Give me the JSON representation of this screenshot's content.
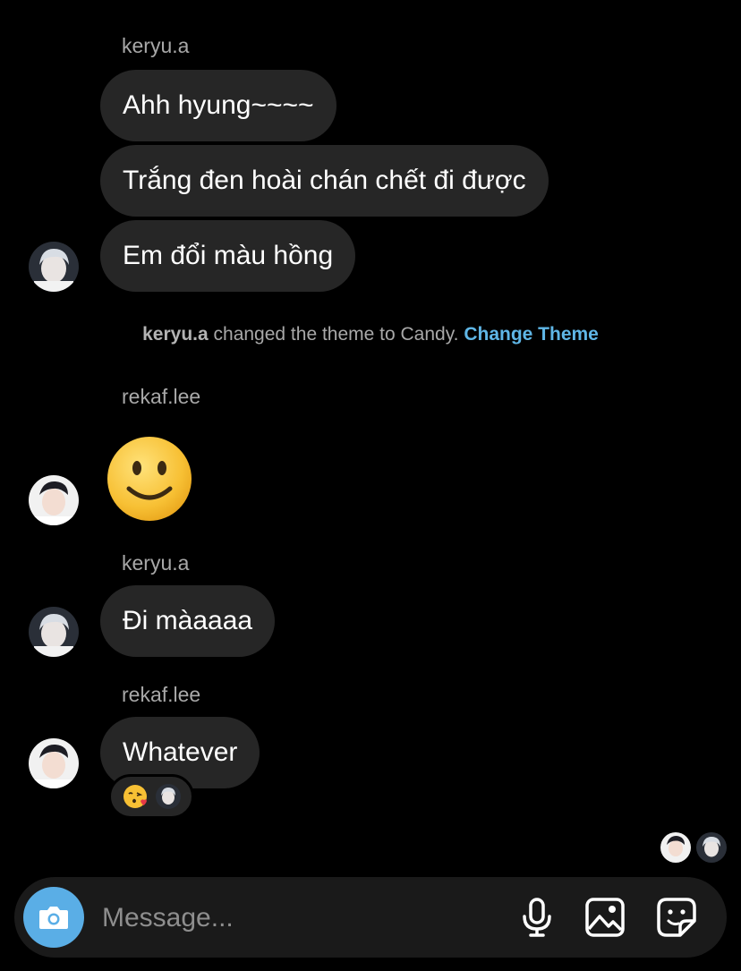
{
  "messages": [
    {
      "sender": "keryu.a",
      "texts": [
        "Ahh hyung~~~~",
        "Trắng đen hoài chán chết đi được",
        "Em đổi màu hồng"
      ]
    },
    {
      "system": {
        "user": "keryu.a",
        "text": " changed the theme to Candy. ",
        "link": "Change Theme"
      }
    },
    {
      "sender": "rekaf.lee",
      "emoji": "slightly-smiling-face"
    },
    {
      "sender": "keryu.a",
      "texts": [
        "Đi màaaaa"
      ]
    },
    {
      "sender": "rekaf.lee",
      "texts": [
        "Whatever"
      ],
      "reaction": "kissing-heart-emoji"
    }
  ],
  "composer": {
    "placeholder": "Message...",
    "icons": [
      "camera-icon",
      "microphone-icon",
      "gallery-icon",
      "sticker-icon"
    ]
  },
  "colors": {
    "background": "#000000",
    "bubble": "#262626",
    "accent": "#5aaee6",
    "link": "#5fb6e6",
    "secondary_text": "#a8a8a8"
  }
}
